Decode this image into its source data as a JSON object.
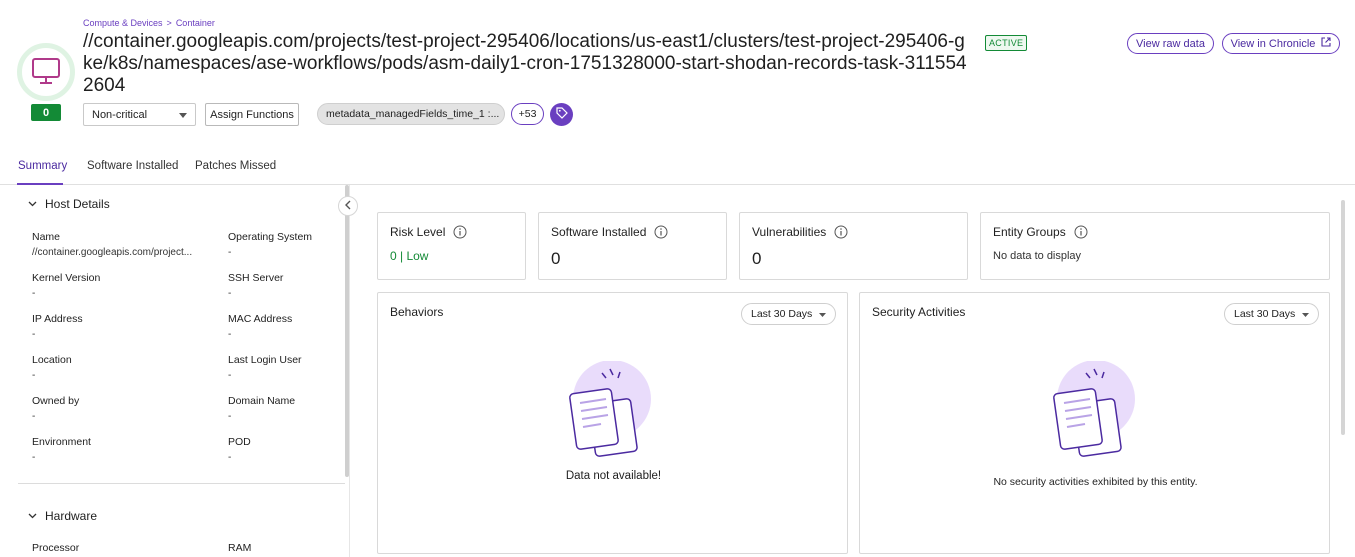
{
  "header": {
    "breadcrumb": [
      "Compute & Devices",
      ">",
      "Container"
    ],
    "title": "//container.googleapis.com/projects/test-project-295406/locations/us-east1/clusters/test-project-295406-gke/k8s/namespaces/ase-workflows/pods/asm-daily1-cron-1751328000-start-shodan-records-task-3115542604",
    "status": "ACTIVE",
    "score": "0",
    "view_raw_label": "View raw data",
    "view_chronicle_label": "View in Chronicle",
    "criticality": "Non-critical",
    "assign_label": "Assign Functions",
    "tag_label": "metadata_managedFields_time_1 :...",
    "more_tags": "+53"
  },
  "tabs": [
    "Summary",
    "Software Installed",
    "Patches Missed"
  ],
  "host_details": {
    "title": "Host Details",
    "fields": [
      {
        "label": "Name",
        "value": "//container.googleapis.com/project..."
      },
      {
        "label": "Operating System",
        "value": "-"
      },
      {
        "label": "Kernel Version",
        "value": "-"
      },
      {
        "label": "SSH Server",
        "value": "-"
      },
      {
        "label": "IP Address",
        "value": "-"
      },
      {
        "label": "MAC Address",
        "value": "-"
      },
      {
        "label": "Location",
        "value": "-"
      },
      {
        "label": "Last Login User",
        "value": "-"
      },
      {
        "label": "Owned by",
        "value": "-"
      },
      {
        "label": "Domain Name",
        "value": "-"
      },
      {
        "label": "Environment",
        "value": "-"
      },
      {
        "label": "POD",
        "value": "-"
      }
    ]
  },
  "hardware": {
    "title": "Hardware",
    "fields": [
      {
        "label": "Processor"
      },
      {
        "label": "RAM"
      }
    ]
  },
  "metrics": {
    "risk_level": {
      "label": "Risk Level",
      "value": "0 | Low"
    },
    "software_installed": {
      "label": "Software Installed",
      "value": "0"
    },
    "vulnerabilities": {
      "label": "Vulnerabilities",
      "value": "0"
    },
    "entity_groups": {
      "label": "Entity Groups",
      "value": "No data to display"
    }
  },
  "behaviors": {
    "title": "Behaviors",
    "range": "Last 30 Days",
    "empty": "Data not available!"
  },
  "security_activities": {
    "title": "Security Activities",
    "range": "Last 30 Days",
    "empty": "No security activities exhibited by this entity."
  },
  "colors": {
    "accent": "#6a3fc0",
    "success": "#138a36"
  }
}
